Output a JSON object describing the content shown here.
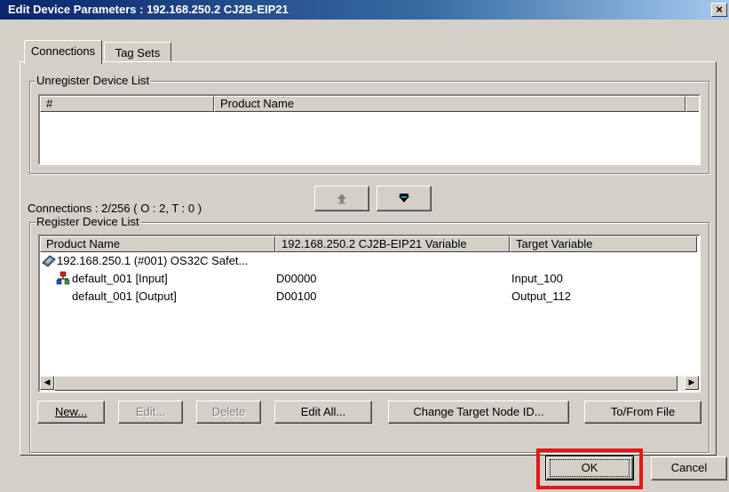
{
  "window": {
    "title": "Edit Device Parameters : 192.168.250.2 CJ2B-EIP21",
    "close_label": "×"
  },
  "tabs": [
    {
      "label": "Connections",
      "active": true
    },
    {
      "label": "Tag Sets",
      "active": false
    }
  ],
  "unregister": {
    "group_label": "Unregister Device List",
    "columns": [
      "#",
      "Product Name"
    ]
  },
  "connections_status": "Connections :  2/256 ( O : 2, T : 0 )",
  "move_buttons": {
    "up_icon": "arrow-up-icon",
    "down_icon": "arrow-down-icon"
  },
  "register": {
    "group_label": "Register Device List",
    "columns": [
      "Product Name",
      "192.168.250.2 CJ2B-EIP21 Variable",
      "Target Variable"
    ],
    "rows": [
      {
        "product": "192.168.250.1 (#001) OS32C Safet...",
        "variable": "",
        "target": "",
        "icon": "device-icon"
      },
      {
        "product": "default_001 [Input]",
        "variable": "D00000",
        "target": "Input_100",
        "icon": "connection-icon"
      },
      {
        "product": "default_001 [Output]",
        "variable": "D00100",
        "target": "Output_112",
        "icon": ""
      }
    ]
  },
  "buttons": {
    "new": "New...",
    "edit": "Edit...",
    "delete": "Delete",
    "edit_all": "Edit All...",
    "change_target": "Change Target Node ID...",
    "to_from_file": "To/From File",
    "ok": "OK",
    "cancel": "Cancel"
  },
  "colors": {
    "title_start": "#0a246a",
    "dialog_face": "#d4d0c8",
    "highlight": "#e8141b"
  }
}
